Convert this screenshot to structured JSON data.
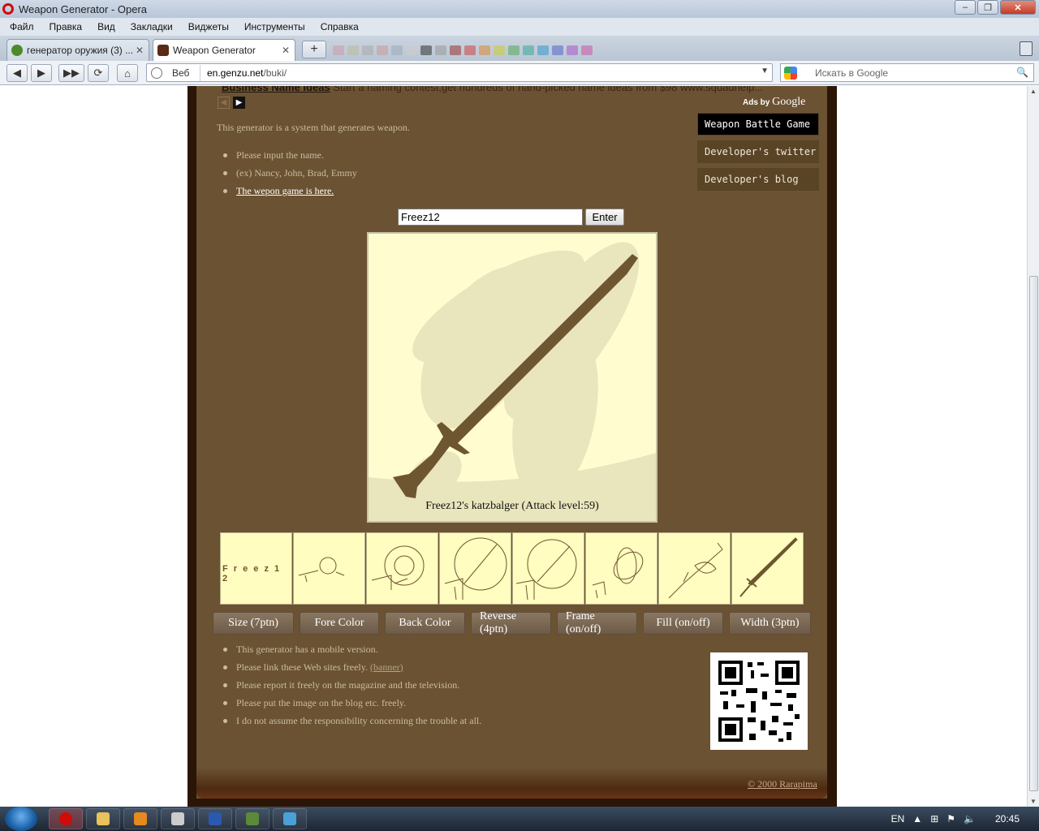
{
  "window": {
    "title": "Weapon Generator - Opera",
    "min_icon": "minimize-icon",
    "max_icon": "maximize-icon",
    "close_icon": "close-icon"
  },
  "menu": [
    "Файл",
    "Правка",
    "Вид",
    "Закладки",
    "Виджеты",
    "Инструменты",
    "Справка"
  ],
  "tabs": [
    {
      "label": "генератор оружия (3) ...",
      "active": false
    },
    {
      "label": "Weapon Generator",
      "active": true
    }
  ],
  "address": {
    "web_label": "Веб",
    "url_host": "en.genzu.net",
    "url_path": "/buki/"
  },
  "search": {
    "placeholder": "Искать в Google"
  },
  "page": {
    "ad_title": "Business Name Ideas",
    "ad_text": "Start a naming contest,get hundreds of hand-picked name ideas from $98 www.squadhelp...",
    "ads_by": "Ads by",
    "ads_brand": "Google",
    "intro": "This generator is a system that generates weapon.",
    "instructions": [
      "Please input the name.",
      "(ex) Nancy, John, Brad, Emmy"
    ],
    "game_link": "The wepon game is here.",
    "side_links": [
      "Weapon Battle Game",
      "Developer's twitter",
      "Developer's blog"
    ],
    "name_value": "Freez12",
    "enter_label": "Enter",
    "weapon_caption": "Freez12's katzbalger (Attack level:59)",
    "thumb_first_text": "F r e e z 1 2",
    "thumb_count": 8,
    "option_buttons": [
      "Size (7ptn)",
      "Fore Color",
      "Back Color",
      "Reverse (4ptn)",
      "Frame (on/off)",
      "Fill (on/off)",
      "Width (3ptn)"
    ],
    "notes": [
      "This generator has a mobile version.",
      "Please link these Web sites freely.",
      "Please report it freely on the magazine and the television.",
      "Please put the image on the blog etc. freely.",
      "I do not assume the responsibility concerning the trouble at all."
    ],
    "banner_link": "(banner)",
    "copyright": "© 2000 Rarapima"
  },
  "taskbar": {
    "lang": "EN",
    "time": "20:45"
  },
  "colors": {
    "page_bg": "#6b5232",
    "image_bg": "#fffdd0",
    "weapon_fill": "#6e5630"
  }
}
